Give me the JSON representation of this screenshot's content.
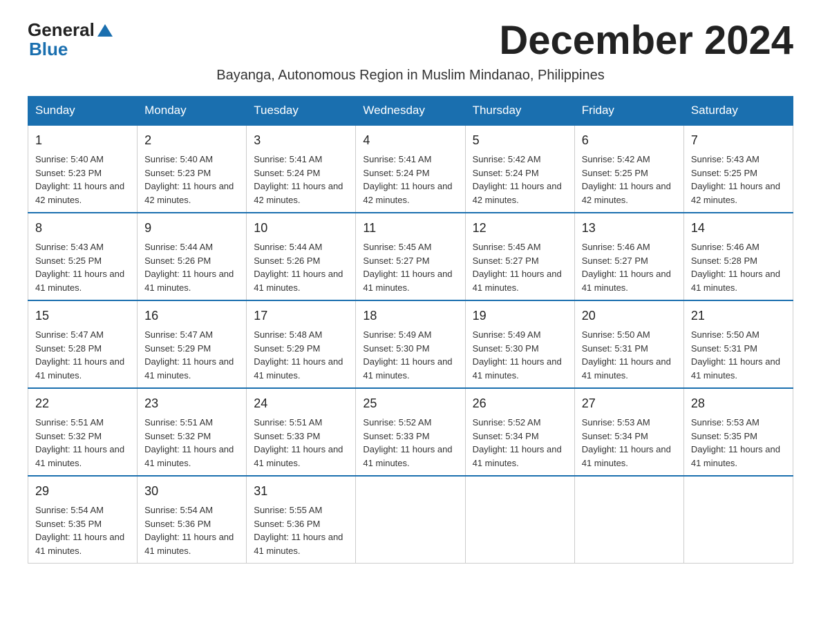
{
  "logo": {
    "line1": "General",
    "arrow": "▲",
    "line2": "Blue"
  },
  "title": "December 2024",
  "subtitle": "Bayanga, Autonomous Region in Muslim Mindanao, Philippines",
  "days_of_week": [
    "Sunday",
    "Monday",
    "Tuesday",
    "Wednesday",
    "Thursday",
    "Friday",
    "Saturday"
  ],
  "weeks": [
    [
      {
        "day": "1",
        "sunrise": "5:40 AM",
        "sunset": "5:23 PM",
        "daylight": "11 hours and 42 minutes."
      },
      {
        "day": "2",
        "sunrise": "5:40 AM",
        "sunset": "5:23 PM",
        "daylight": "11 hours and 42 minutes."
      },
      {
        "day": "3",
        "sunrise": "5:41 AM",
        "sunset": "5:24 PM",
        "daylight": "11 hours and 42 minutes."
      },
      {
        "day": "4",
        "sunrise": "5:41 AM",
        "sunset": "5:24 PM",
        "daylight": "11 hours and 42 minutes."
      },
      {
        "day": "5",
        "sunrise": "5:42 AM",
        "sunset": "5:24 PM",
        "daylight": "11 hours and 42 minutes."
      },
      {
        "day": "6",
        "sunrise": "5:42 AM",
        "sunset": "5:25 PM",
        "daylight": "11 hours and 42 minutes."
      },
      {
        "day": "7",
        "sunrise": "5:43 AM",
        "sunset": "5:25 PM",
        "daylight": "11 hours and 42 minutes."
      }
    ],
    [
      {
        "day": "8",
        "sunrise": "5:43 AM",
        "sunset": "5:25 PM",
        "daylight": "11 hours and 41 minutes."
      },
      {
        "day": "9",
        "sunrise": "5:44 AM",
        "sunset": "5:26 PM",
        "daylight": "11 hours and 41 minutes."
      },
      {
        "day": "10",
        "sunrise": "5:44 AM",
        "sunset": "5:26 PM",
        "daylight": "11 hours and 41 minutes."
      },
      {
        "day": "11",
        "sunrise": "5:45 AM",
        "sunset": "5:27 PM",
        "daylight": "11 hours and 41 minutes."
      },
      {
        "day": "12",
        "sunrise": "5:45 AM",
        "sunset": "5:27 PM",
        "daylight": "11 hours and 41 minutes."
      },
      {
        "day": "13",
        "sunrise": "5:46 AM",
        "sunset": "5:27 PM",
        "daylight": "11 hours and 41 minutes."
      },
      {
        "day": "14",
        "sunrise": "5:46 AM",
        "sunset": "5:28 PM",
        "daylight": "11 hours and 41 minutes."
      }
    ],
    [
      {
        "day": "15",
        "sunrise": "5:47 AM",
        "sunset": "5:28 PM",
        "daylight": "11 hours and 41 minutes."
      },
      {
        "day": "16",
        "sunrise": "5:47 AM",
        "sunset": "5:29 PM",
        "daylight": "11 hours and 41 minutes."
      },
      {
        "day": "17",
        "sunrise": "5:48 AM",
        "sunset": "5:29 PM",
        "daylight": "11 hours and 41 minutes."
      },
      {
        "day": "18",
        "sunrise": "5:49 AM",
        "sunset": "5:30 PM",
        "daylight": "11 hours and 41 minutes."
      },
      {
        "day": "19",
        "sunrise": "5:49 AM",
        "sunset": "5:30 PM",
        "daylight": "11 hours and 41 minutes."
      },
      {
        "day": "20",
        "sunrise": "5:50 AM",
        "sunset": "5:31 PM",
        "daylight": "11 hours and 41 minutes."
      },
      {
        "day": "21",
        "sunrise": "5:50 AM",
        "sunset": "5:31 PM",
        "daylight": "11 hours and 41 minutes."
      }
    ],
    [
      {
        "day": "22",
        "sunrise": "5:51 AM",
        "sunset": "5:32 PM",
        "daylight": "11 hours and 41 minutes."
      },
      {
        "day": "23",
        "sunrise": "5:51 AM",
        "sunset": "5:32 PM",
        "daylight": "11 hours and 41 minutes."
      },
      {
        "day": "24",
        "sunrise": "5:51 AM",
        "sunset": "5:33 PM",
        "daylight": "11 hours and 41 minutes."
      },
      {
        "day": "25",
        "sunrise": "5:52 AM",
        "sunset": "5:33 PM",
        "daylight": "11 hours and 41 minutes."
      },
      {
        "day": "26",
        "sunrise": "5:52 AM",
        "sunset": "5:34 PM",
        "daylight": "11 hours and 41 minutes."
      },
      {
        "day": "27",
        "sunrise": "5:53 AM",
        "sunset": "5:34 PM",
        "daylight": "11 hours and 41 minutes."
      },
      {
        "day": "28",
        "sunrise": "5:53 AM",
        "sunset": "5:35 PM",
        "daylight": "11 hours and 41 minutes."
      }
    ],
    [
      {
        "day": "29",
        "sunrise": "5:54 AM",
        "sunset": "5:35 PM",
        "daylight": "11 hours and 41 minutes."
      },
      {
        "day": "30",
        "sunrise": "5:54 AM",
        "sunset": "5:36 PM",
        "daylight": "11 hours and 41 minutes."
      },
      {
        "day": "31",
        "sunrise": "5:55 AM",
        "sunset": "5:36 PM",
        "daylight": "11 hours and 41 minutes."
      },
      null,
      null,
      null,
      null
    ]
  ]
}
